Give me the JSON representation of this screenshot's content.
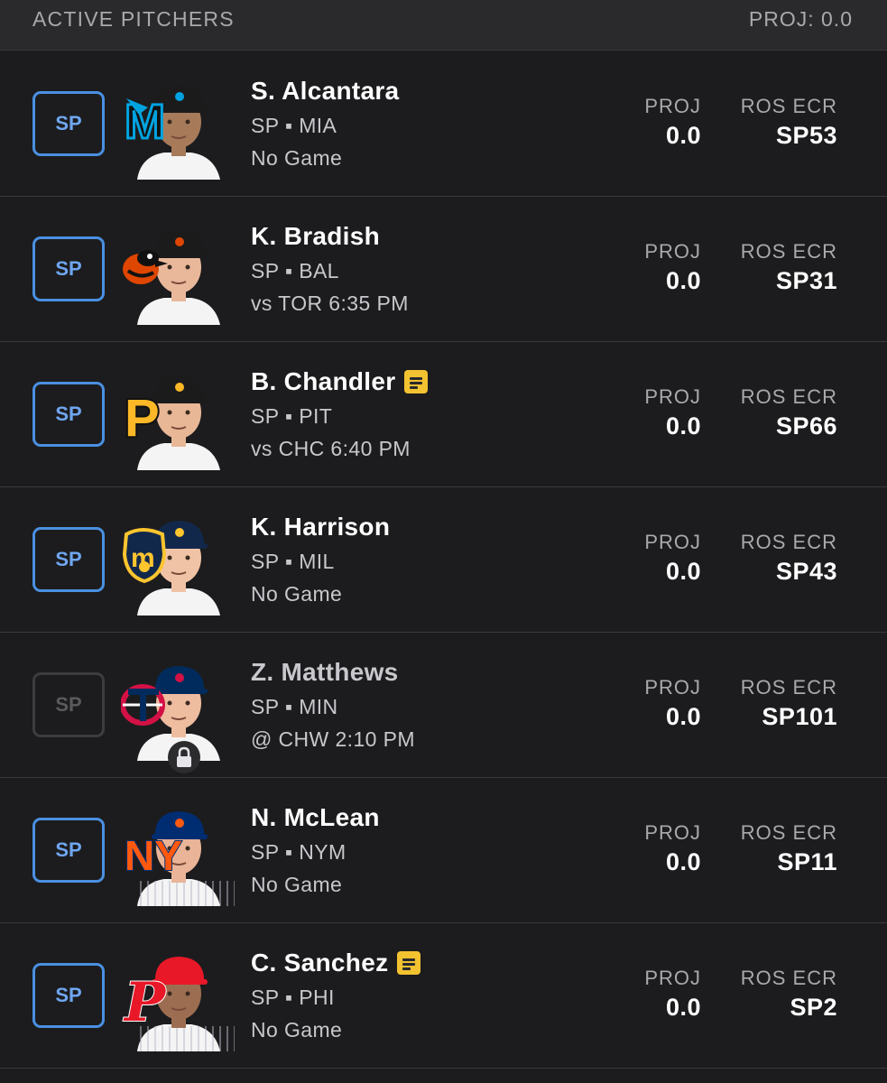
{
  "header": {
    "title": "ACTIVE PITCHERS",
    "proj": "PROJ: 0.0"
  },
  "colors": {
    "accent": "#4a90e2",
    "note": "#f2c230",
    "background": "#1c1c1e"
  },
  "stat_labels": {
    "proj": "PROJ",
    "ecr": "ROS ECR"
  },
  "players": [
    {
      "slot": "SP",
      "name": "S. Alcantara",
      "team_line": "SP ▪ MIA",
      "game": "No Game",
      "proj": "0.0",
      "ecr": "SP53",
      "team": "MIA",
      "team_color": "#00a3e0",
      "cap_color": "#1b1b1b",
      "skin": "#a77b5a",
      "note": false,
      "locked": false
    },
    {
      "slot": "SP",
      "name": "K. Bradish",
      "team_line": "SP ▪ BAL",
      "game": "vs TOR 6:35 PM",
      "proj": "0.0",
      "ecr": "SP31",
      "team": "BAL",
      "team_color": "#df4601",
      "cap_color": "#1b1b1b",
      "skin": "#e9b89b",
      "note": false,
      "locked": false
    },
    {
      "slot": "SP",
      "name": "B. Chandler",
      "team_line": "SP ▪ PIT",
      "game": "vs CHC 6:40 PM",
      "proj": "0.0",
      "ecr": "SP66",
      "team": "PIT",
      "team_color": "#fdb827",
      "cap_color": "#1b1b1b",
      "skin": "#e8b796",
      "note": true,
      "locked": false
    },
    {
      "slot": "SP",
      "name": "K. Harrison",
      "team_line": "SP ▪ MIL",
      "game": "No Game",
      "proj": "0.0",
      "ecr": "SP43",
      "team": "MIL",
      "team_color": "#ffc52f",
      "cap_color": "#12284b",
      "skin": "#f0c3a6",
      "note": false,
      "locked": false
    },
    {
      "slot": "SP",
      "name": "Z. Matthews",
      "team_line": "SP ▪ MIN",
      "game": "@ CHW 2:10 PM",
      "proj": "0.0",
      "ecr": "SP101",
      "team": "MIN",
      "team_color": "#d31145",
      "cap_color": "#002b5c",
      "skin": "#eebc9f",
      "note": false,
      "locked": true
    },
    {
      "slot": "SP",
      "name": "N. McLean",
      "team_line": "SP ▪ NYM",
      "game": "No Game",
      "proj": "0.0",
      "ecr": "SP11",
      "team": "NYM",
      "team_color": "#ff5910",
      "cap_color": "#002d72",
      "skin": "#e9b497",
      "note": false,
      "locked": false
    },
    {
      "slot": "SP",
      "name": "C. Sanchez",
      "team_line": "SP ▪ PHI",
      "game": "No Game",
      "proj": "0.0",
      "ecr": "SP2",
      "team": "PHI",
      "team_color": "#e81828",
      "cap_color": "#e81828",
      "skin": "#9c6d50",
      "note": true,
      "locked": false
    }
  ]
}
